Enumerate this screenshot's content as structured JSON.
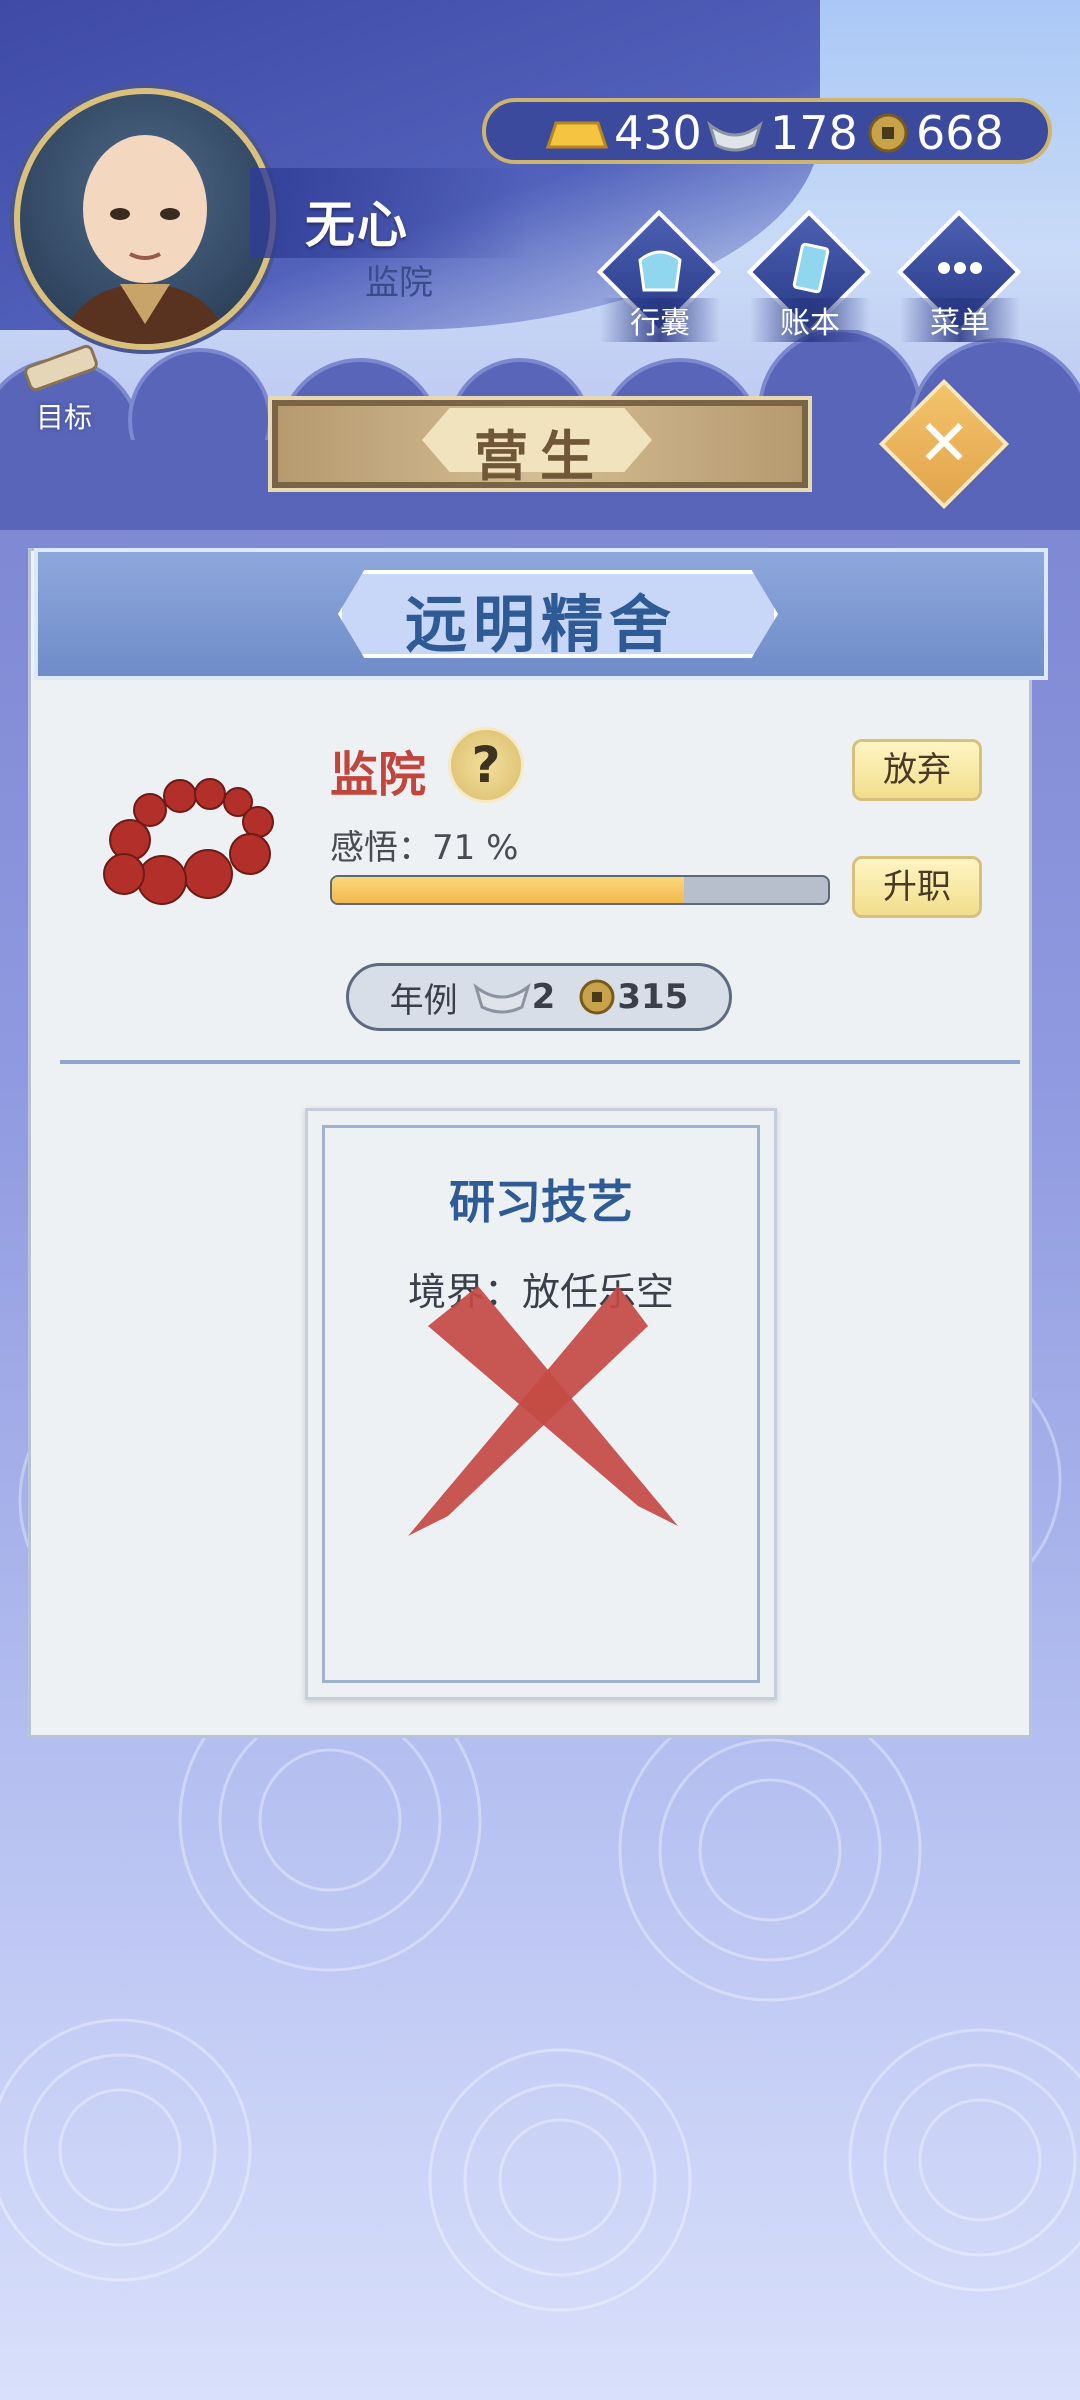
{
  "player": {
    "name": "无心",
    "title": "监院"
  },
  "currency": [
    {
      "icon": "gold-bar-icon",
      "value": "430"
    },
    {
      "icon": "silver-ingot-icon",
      "value": "178"
    },
    {
      "icon": "copper-coin-icon",
      "value": "668"
    }
  ],
  "nav": [
    {
      "icon": "bag-icon",
      "label": "行囊"
    },
    {
      "icon": "ledger-icon",
      "label": "账本"
    },
    {
      "icon": "menu-icon",
      "label": "菜单"
    }
  ],
  "target": {
    "label": "目标"
  },
  "banner": {
    "title": "营生"
  },
  "panel": {
    "title": "远明精舍",
    "role": "监院",
    "insight_label": "感悟：71 %",
    "insight_progress": 0.71,
    "abandon_label": "放弃",
    "promote_label": "升职",
    "salary": {
      "label": "年例",
      "silver": "2",
      "copper": "315"
    }
  },
  "card": {
    "title": "研习技艺",
    "realm": "境界：放任乐空"
  },
  "colors": {
    "accent": "#2e5a96",
    "role": "#c2453d",
    "progress": "#f2b84f",
    "gold_button": "#f1de8c"
  }
}
